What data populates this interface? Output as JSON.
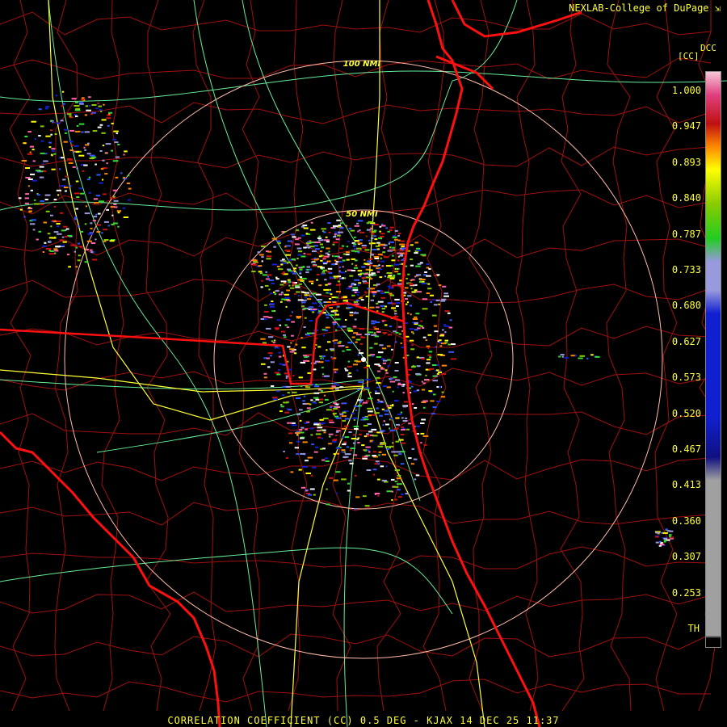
{
  "header": {
    "credit": "NEXLAB-College of DuPage",
    "credit_icon": "corner-arrow-icon",
    "product_code": "DCC",
    "product_unit": "[CC]"
  },
  "map": {
    "radar_site": "KJAX",
    "range_rings": [
      {
        "label": "50 NMI",
        "nmi": 50
      },
      {
        "label": "100 NMI",
        "nmi": 100
      }
    ]
  },
  "colorbar": {
    "ticks": [
      "1.000",
      "0.947",
      "0.893",
      "0.840",
      "0.787",
      "0.733",
      "0.680",
      "0.627",
      "0.573",
      "0.520",
      "0.467",
      "0.413",
      "0.360",
      "0.307",
      "0.253",
      "TH"
    ],
    "colors": {
      "top": "#f8c8d8",
      "pink": "#e04080",
      "red": "#c01010",
      "orange": "#ff8800",
      "yellow": "#ffff00",
      "lime": "#88cc00",
      "green": "#22cc22",
      "lavender": "#9999dd",
      "blue": "#1020d0",
      "navy": "#101080",
      "gray": "#a0a0a0",
      "bottom": "#000000"
    }
  },
  "colors": {
    "state_border": "#ff1010",
    "county_border": "#a01010",
    "highway": "#66ee99",
    "interstate": "#ffff33",
    "ring": "#ffbbaa",
    "text": "#ffff33"
  },
  "footer": {
    "text": "CORRELATION COEFFICIENT (CC) 0.5 DEG - KJAX 14 DEC 25 11:37"
  }
}
